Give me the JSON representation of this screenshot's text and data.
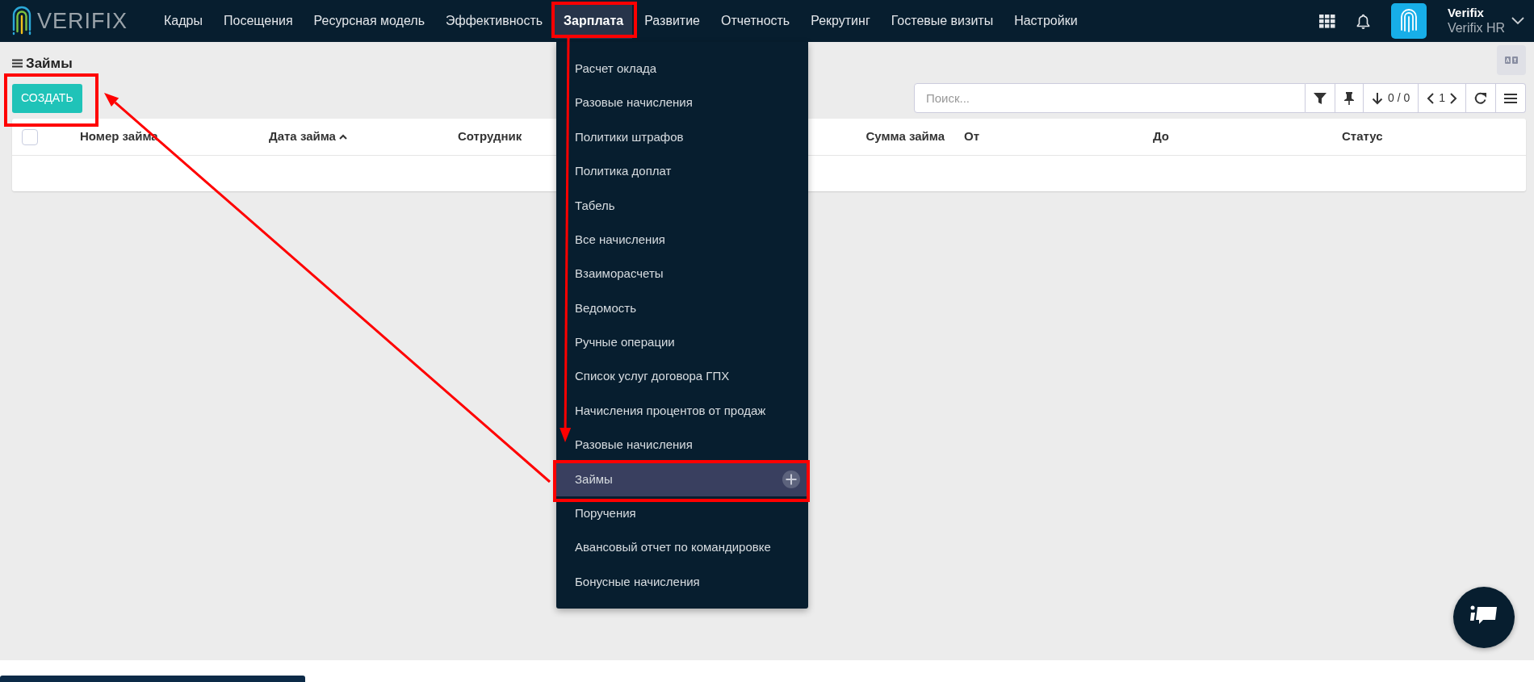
{
  "app": {
    "logo": "VERIFIX"
  },
  "nav": [
    {
      "label": "Кадры",
      "selected": false
    },
    {
      "label": "Посещения",
      "selected": false
    },
    {
      "label": "Ресурсная модель",
      "selected": false
    },
    {
      "label": "Эффективность",
      "selected": false
    },
    {
      "label": "Зарплата",
      "selected": true
    },
    {
      "label": "Развитие",
      "selected": false
    },
    {
      "label": "Отчетность",
      "selected": false
    },
    {
      "label": "Рекрутинг",
      "selected": false
    },
    {
      "label": "Гостевые визиты",
      "selected": false
    },
    {
      "label": "Настройки",
      "selected": false
    }
  ],
  "user": {
    "name": "Verifix",
    "company": "Verifix HR"
  },
  "page": {
    "title": "Займы",
    "create_button": "СОЗДАТЬ",
    "search": {
      "placeholder": "Поиск..."
    },
    "counter": "0 / 0",
    "pager": "1"
  },
  "table": {
    "select_all": {
      "checked": false
    },
    "columns": [
      {
        "label": "Номер займа",
        "sorted": false
      },
      {
        "label": "Дата займа",
        "sorted": true
      },
      {
        "label": "Сотрудник",
        "sorted": false
      },
      {
        "label": "Сумма займа",
        "sorted": false
      },
      {
        "label": "От",
        "sorted": false
      },
      {
        "label": "До",
        "sorted": false
      },
      {
        "label": "Статус",
        "sorted": false
      }
    ]
  },
  "dropdown": {
    "items": [
      {
        "label": "Расчет оклада",
        "selected": false
      },
      {
        "label": "Разовые начисления",
        "selected": false
      },
      {
        "label": "Политики штрафов",
        "selected": false
      },
      {
        "label": "Политика доплат",
        "selected": false
      },
      {
        "label": "Табель",
        "selected": false
      },
      {
        "label": "Все начисления",
        "selected": false
      },
      {
        "label": "Взаиморасчеты",
        "selected": false
      },
      {
        "label": "Ведомость",
        "selected": false
      },
      {
        "label": "Ручные операции",
        "selected": false
      },
      {
        "label": "Список услуг договора ГПХ",
        "selected": false
      },
      {
        "label": "Начисления процентов от продаж",
        "selected": false
      },
      {
        "label": "Разовые начисления",
        "selected": false
      },
      {
        "label": "Займы",
        "selected": true
      },
      {
        "label": "Поручения",
        "selected": false
      },
      {
        "label": "Авансовый отчет по командировке",
        "selected": false
      },
      {
        "label": "Бонусные начисления",
        "selected": false
      }
    ]
  }
}
